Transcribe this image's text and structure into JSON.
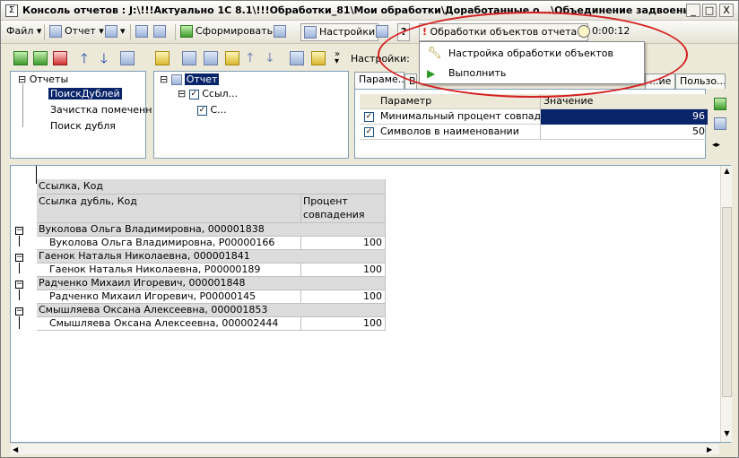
{
  "window": {
    "title": "Консоль отчетов : J:\\!!!Актуально 1С 8.1\\!!!Обработки_81\\Мои обработки\\Доработанные о...\\Объединение задвоеных.dcf",
    "app_icon": "console-app-icon",
    "controls": [
      "_",
      "□",
      "X"
    ]
  },
  "toolbar": {
    "file": "Файл",
    "report": "Отчет",
    "generate": "Сформировать",
    "settings": "Настройки",
    "help": "?",
    "processing": "Обработки объектов отчета",
    "timer": "0:00:12"
  },
  "processing_menu": {
    "items": [
      {
        "label": "Настройка обработки объектов",
        "icon": "wrench-icon"
      },
      {
        "label": "Выполнить",
        "icon": "play-icon"
      }
    ]
  },
  "settings_label": "Настройки:",
  "reports_tree": {
    "root": "Отчеты",
    "items": [
      "ПоискДублей",
      "Зачистка помеченн",
      "Поиск дубля"
    ],
    "selected": "ПоискДублей"
  },
  "structure_tree": {
    "root": "Отчет",
    "child1": "Ссыл...",
    "child2": "С..."
  },
  "tabs": [
    "Параме...",
    "В",
    "...ие",
    "Пользо..."
  ],
  "params_table": {
    "headers": {
      "param": "Параметр",
      "value": "Значение"
    },
    "rows": [
      {
        "name": "Минимальный процент совпаде...",
        "value": "96"
      },
      {
        "name": "Символов в наименовании",
        "value": "50"
      }
    ]
  },
  "report": {
    "header_group": "Ссылка, Код",
    "header_dup": "Ссылка дубль, Код",
    "header_pct": "Процент совпадения",
    "groups": [
      {
        "main": "Вуколова Ольга Владимировна, 000001838",
        "dup": "Вуколова Ольга Владимировна, Р00000166",
        "pct": "100"
      },
      {
        "main": "Гаенок Наталья Николаевна, 000001841",
        "dup": "Гаенок Наталья Николаевна, Р00000189",
        "pct": "100"
      },
      {
        "main": "Радченко Михаил Игоревич, 000001848",
        "dup": "Радченко Михаил Игоревич, Р00000145",
        "pct": "100"
      },
      {
        "main": "Смышляева Оксана Алексеевна, 000001853",
        "dup": "Смышляева Оксана Алексеевна, 000002444",
        "pct": "100"
      }
    ]
  },
  "colors": {
    "selection": "#0a246a",
    "highlight_ellipse": "#d42020",
    "group_row": "#dcdcdc"
  }
}
